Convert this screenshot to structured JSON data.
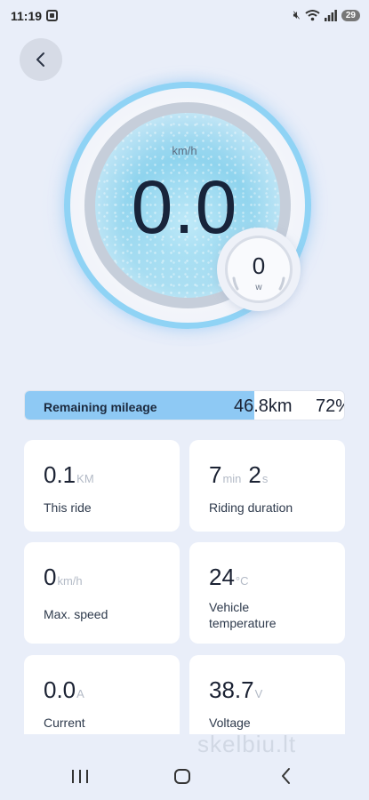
{
  "status_bar": {
    "time": "11:19",
    "battery": "29",
    "icons": [
      "screenshot-icon",
      "mute-icon",
      "wifi-icon",
      "signal-icon"
    ]
  },
  "gauge": {
    "speed_unit": "km/h",
    "speed_value": "0.0",
    "power_value": "0",
    "power_unit": "w",
    "accent_color": "#8fd3f5"
  },
  "mileage": {
    "label": "Remaining mileage",
    "value": "46.8km",
    "percent_text": "72%",
    "fill_fraction": 0.72,
    "fill_color": "#8ec9f4"
  },
  "stats": {
    "this_ride": {
      "value": "0.1",
      "unit": "KM",
      "label": "This ride"
    },
    "riding_duration": {
      "minutes": "7",
      "min_unit": "min",
      "seconds": "2",
      "sec_unit": "s",
      "label": "Riding duration"
    },
    "max_speed": {
      "value": "0",
      "unit": "km/h",
      "label": "Max. speed"
    },
    "vehicle_temperature": {
      "value": "24",
      "unit": "°C",
      "label_line1": "Vehicle",
      "label_line2": "temperature"
    },
    "current": {
      "value": "0.0",
      "unit": "A",
      "label": "Current"
    },
    "voltage": {
      "value": "38.7",
      "unit": "V",
      "label": "Voltage"
    }
  },
  "watermark": "skelbiu.lt"
}
